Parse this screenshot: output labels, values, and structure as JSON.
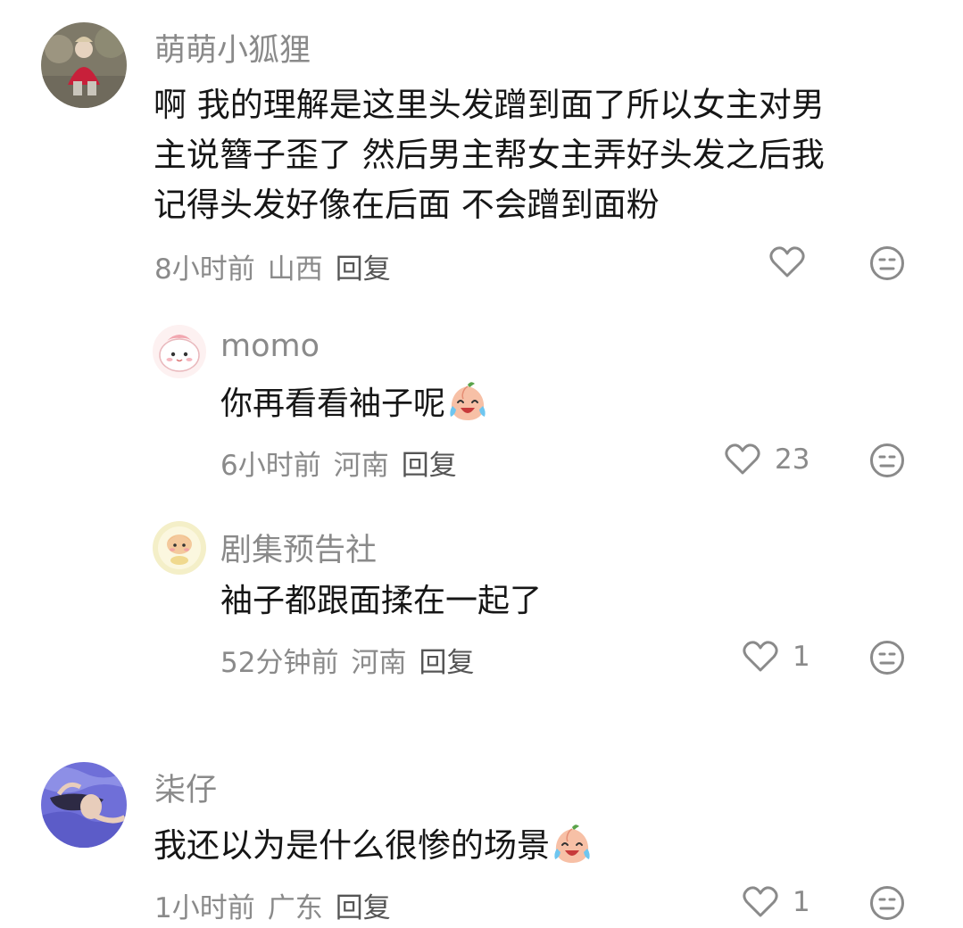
{
  "comments": [
    {
      "author": "萌萌小狐狸",
      "text_lines": [
        "啊 我的理解是这里头发蹭到面了所以女主对男",
        "主说簪子歪了 然后男主帮女主弄好头发之后我",
        "记得头发好像在后面 不会蹭到面粉"
      ],
      "time": "8小时前",
      "location": "山西",
      "reply_label": "回复",
      "likes": "",
      "replies": [
        {
          "author": "momo",
          "text": "你再看看袖子呢",
          "emoji": "crying-laughing-peach",
          "time": "6小时前",
          "location": "河南",
          "reply_label": "回复",
          "likes": "23"
        },
        {
          "author": "剧集预告社",
          "text": "袖子都跟面揉在一起了",
          "time": "52分钟前",
          "location": "河南",
          "reply_label": "回复",
          "likes": "1"
        }
      ]
    },
    {
      "author": "柒仔",
      "text": "我还以为是什么很惨的场景",
      "emoji": "crying-laughing-peach",
      "time": "1小时前",
      "location": "广东",
      "reply_label": "回复",
      "likes": "1"
    }
  ],
  "icons": {
    "like": "heart-outline-icon",
    "dislike": "neutral-face-icon"
  },
  "colors": {
    "text": "#161616",
    "secondary": "#8a8a8a",
    "reply": "#555555",
    "background": "#ffffff"
  }
}
